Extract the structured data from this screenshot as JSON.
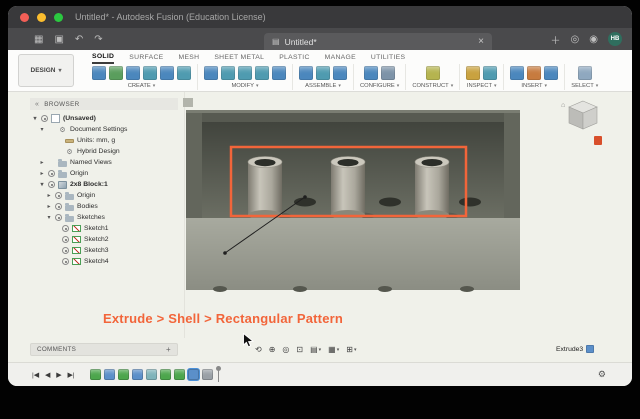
{
  "colors": {
    "accent_orange": "#f2653a",
    "viewport_dark": "#575a51",
    "viewport_light": "#9da094"
  },
  "window": {
    "title": "Untitled* - Autodesk Fusion (Education License)"
  },
  "appbar": {
    "tab_title": "Untitled*",
    "avatar_initials": "HB"
  },
  "ribbon": {
    "design_label": "DESIGN",
    "tabs": [
      {
        "label": "SOLID",
        "active": true
      },
      {
        "label": "SURFACE",
        "active": false
      },
      {
        "label": "MESH",
        "active": false
      },
      {
        "label": "SHEET METAL",
        "active": false
      },
      {
        "label": "PLASTIC",
        "active": false
      },
      {
        "label": "MANAGE",
        "active": false
      },
      {
        "label": "UTILITIES",
        "active": false
      }
    ],
    "groups": [
      {
        "label": "CREATE",
        "icons": [
          "new-component",
          "create-sketch",
          "extrude",
          "revolve",
          "sweep",
          "loft"
        ]
      },
      {
        "label": "MODIFY",
        "icons": [
          "press-pull",
          "fillet",
          "shell",
          "combine",
          "offset-face"
        ]
      },
      {
        "label": "ASSEMBLE",
        "icons": [
          "new-component",
          "joint",
          "rigid-group"
        ]
      },
      {
        "label": "CONFIGURE",
        "icons": [
          "configuration",
          "configuration-table"
        ]
      },
      {
        "label": "CONSTRUCT",
        "icons": [
          "construction-plane"
        ]
      },
      {
        "label": "INSPECT",
        "icons": [
          "measure",
          "section-analysis"
        ]
      },
      {
        "label": "INSERT",
        "icons": [
          "insert-derive",
          "decal",
          "insert-mesh"
        ]
      },
      {
        "label": "SELECT",
        "icons": [
          "select"
        ]
      }
    ]
  },
  "browser": {
    "header": "BROWSER",
    "rows": [
      {
        "label": "(Unsaved)",
        "indent": 0,
        "caret": "open",
        "eye": true,
        "icon": "document",
        "bold": true
      },
      {
        "label": "Document Settings",
        "indent": 1,
        "caret": "open",
        "eye": false,
        "icon": "gear",
        "bold": false
      },
      {
        "label": "Units: mm, g",
        "indent": 2,
        "caret": null,
        "eye": false,
        "icon": "units",
        "bold": false
      },
      {
        "label": "Hybrid Design",
        "indent": 2,
        "caret": null,
        "eye": false,
        "icon": "gear",
        "bold": false
      },
      {
        "label": "Named Views",
        "indent": 1,
        "caret": "closed",
        "eye": false,
        "icon": "folder",
        "bold": false
      },
      {
        "label": "Origin",
        "indent": 1,
        "caret": "closed",
        "eye": true,
        "icon": "folder",
        "bold": false
      },
      {
        "label": "2x8 Block:1",
        "indent": 1,
        "caret": "open",
        "eye": true,
        "icon": "component",
        "bold": true
      },
      {
        "label": "Origin",
        "indent": 2,
        "caret": "closed",
        "eye": true,
        "icon": "folder",
        "bold": false
      },
      {
        "label": "Bodies",
        "indent": 2,
        "caret": "closed",
        "eye": true,
        "icon": "folder",
        "bold": false
      },
      {
        "label": "Sketches",
        "indent": 2,
        "caret": "open",
        "eye": true,
        "icon": "folder",
        "bold": false
      },
      {
        "label": "Sketch1",
        "indent": 3,
        "caret": null,
        "eye": true,
        "icon": "sketch",
        "bold": false
      },
      {
        "label": "Sketch2",
        "indent": 3,
        "caret": null,
        "eye": true,
        "icon": "sketch",
        "bold": false
      },
      {
        "label": "Sketch3",
        "indent": 3,
        "caret": null,
        "eye": true,
        "icon": "sketch",
        "bold": false
      },
      {
        "label": "Sketch4",
        "indent": 3,
        "caret": null,
        "eye": true,
        "icon": "sketch",
        "bold": false
      }
    ]
  },
  "annotation": {
    "text": "Extrude > Shell > Rectangular Pattern"
  },
  "comments": {
    "label": "COMMENTS",
    "add_label": "+"
  },
  "canvas_toolbar": {
    "items": [
      {
        "name": "orbit",
        "caret": false
      },
      {
        "name": "pan",
        "caret": false
      },
      {
        "name": "zoom",
        "caret": false
      },
      {
        "name": "fit",
        "caret": false
      },
      {
        "name": "display-settings",
        "caret": true
      },
      {
        "name": "grid-and-snaps",
        "caret": true
      },
      {
        "name": "viewports",
        "caret": true
      }
    ]
  },
  "status": {
    "feature_label": "Extrude3"
  },
  "timeline": {
    "playback": [
      "go-to-start",
      "step-back",
      "play",
      "go-to-end"
    ],
    "features": [
      {
        "type": "sketch",
        "selected": false
      },
      {
        "type": "extrude",
        "selected": false
      },
      {
        "type": "sketch",
        "selected": false
      },
      {
        "type": "extrude",
        "selected": false
      },
      {
        "type": "shell",
        "selected": false
      },
      {
        "type": "sketch",
        "selected": false
      },
      {
        "type": "sketch",
        "selected": false
      },
      {
        "type": "extrude",
        "selected": true
      },
      {
        "type": "pattern",
        "selected": false
      }
    ]
  }
}
